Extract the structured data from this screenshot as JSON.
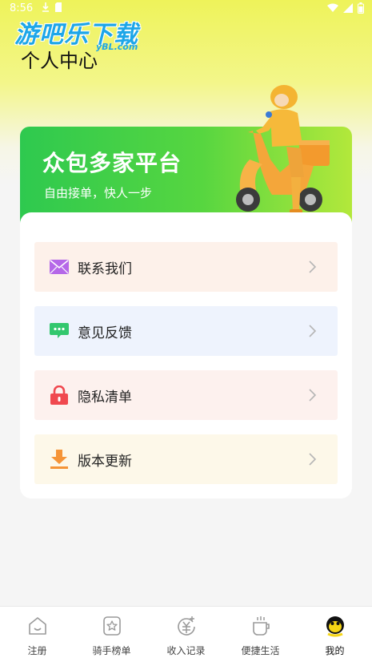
{
  "status_bar": {
    "time": "8:56"
  },
  "watermark": {
    "text": "游吧乐下载",
    "sub": "yBL.com"
  },
  "header": {
    "title": "个人中心"
  },
  "banner": {
    "title": "众包多家平台",
    "subtitle": "自由接单，快人一步"
  },
  "menu": [
    {
      "label": "联系我们",
      "bg": "#fdf1ea",
      "icon": "mail-icon"
    },
    {
      "label": "意见反馈",
      "bg": "#eef3fd",
      "icon": "chat-bubble-icon"
    },
    {
      "label": "隐私清单",
      "bg": "#fdf1ee",
      "icon": "lock-icon"
    },
    {
      "label": "版本更新",
      "bg": "#fdf8e9",
      "icon": "download-icon"
    }
  ],
  "tabs": [
    {
      "label": "注册",
      "icon": "home-icon"
    },
    {
      "label": "骑手榜单",
      "icon": "ranking-icon"
    },
    {
      "label": "收入记录",
      "icon": "income-icon"
    },
    {
      "label": "便捷生活",
      "icon": "cup-icon"
    },
    {
      "label": "我的",
      "icon": "profile-icon",
      "active": true
    }
  ],
  "colors": {
    "accent": "#4ccf45",
    "active_tab": "#f5d515"
  }
}
